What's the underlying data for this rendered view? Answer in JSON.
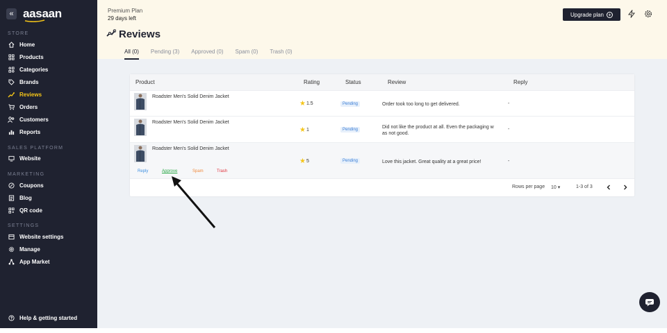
{
  "sidebar": {
    "logo": "aasaan",
    "collapse_glyph": "«",
    "sections": {
      "store": "STORE",
      "sales": "SALES PLATFORM",
      "marketing": "MARKETING",
      "settings": "SETTINGS"
    },
    "items": [
      {
        "label": "Home",
        "icon": "home-icon"
      },
      {
        "label": "Products",
        "icon": "products-icon"
      },
      {
        "label": "Categories",
        "icon": "categories-icon"
      },
      {
        "label": "Brands",
        "icon": "tag-icon"
      },
      {
        "label": "Reviews",
        "icon": "reviews-icon",
        "active": true
      },
      {
        "label": "Orders",
        "icon": "cart-icon"
      },
      {
        "label": "Customers",
        "icon": "users-icon"
      },
      {
        "label": "Reports",
        "icon": "chart-icon"
      },
      {
        "label": "Website",
        "icon": "monitor-icon"
      },
      {
        "label": "Coupons",
        "icon": "coupon-icon"
      },
      {
        "label": "Blog",
        "icon": "blog-icon"
      },
      {
        "label": "QR code",
        "icon": "qr-icon"
      },
      {
        "label": "Website settings",
        "icon": "website-settings-icon"
      },
      {
        "label": "Manage",
        "icon": "gear-icon"
      },
      {
        "label": "App Market",
        "icon": "app-market-icon"
      }
    ],
    "help": "Help & getting started"
  },
  "header": {
    "plan": "Premium Plan",
    "days_left": "29 days left",
    "title": "Reviews",
    "upgrade": "Upgrade plan",
    "tabs": [
      {
        "label": "All (0)",
        "active": true
      },
      {
        "label": "Pending (3)"
      },
      {
        "label": "Approved (0)"
      },
      {
        "label": "Spam (0)"
      },
      {
        "label": "Trash (0)"
      }
    ]
  },
  "table": {
    "columns": [
      "Product",
      "Rating",
      "Status",
      "Review",
      "Reply"
    ],
    "rows": [
      {
        "product": "Roadster Men's Solid Denim Jacket",
        "rating": "1.5",
        "status": "Pending",
        "review": "Order took too long to get delivered.",
        "review2": "",
        "reply": "-"
      },
      {
        "product": "Roadster Men's Solid Denim Jacket",
        "rating": "1",
        "status": "Pending",
        "review": "Did not like the product at all. Even the packaging w",
        "review2": "as not good.",
        "reply": "-"
      },
      {
        "product": "Roadster Men's Solid Denim Jacket",
        "rating": "5",
        "status": "Pending",
        "review": "Love this jacket. Great quality at a great price!",
        "review2": "",
        "reply": "-"
      }
    ],
    "row_actions": {
      "reply": "Reply",
      "approve": "Approve",
      "spam": "Spam",
      "trash": "Trash"
    },
    "pagination": {
      "rows_per_page_label": "Rows per page",
      "rows_per_page": "10",
      "range": "1-3 of 3"
    }
  },
  "colors": {
    "sidebar_bg": "#1f2230",
    "accent": "#f5c518",
    "banner_bg": "#fdf8ea",
    "approve": "#28a745",
    "spam": "#f08a3c",
    "trash": "#e0303a",
    "reply": "#3d8fe0"
  }
}
